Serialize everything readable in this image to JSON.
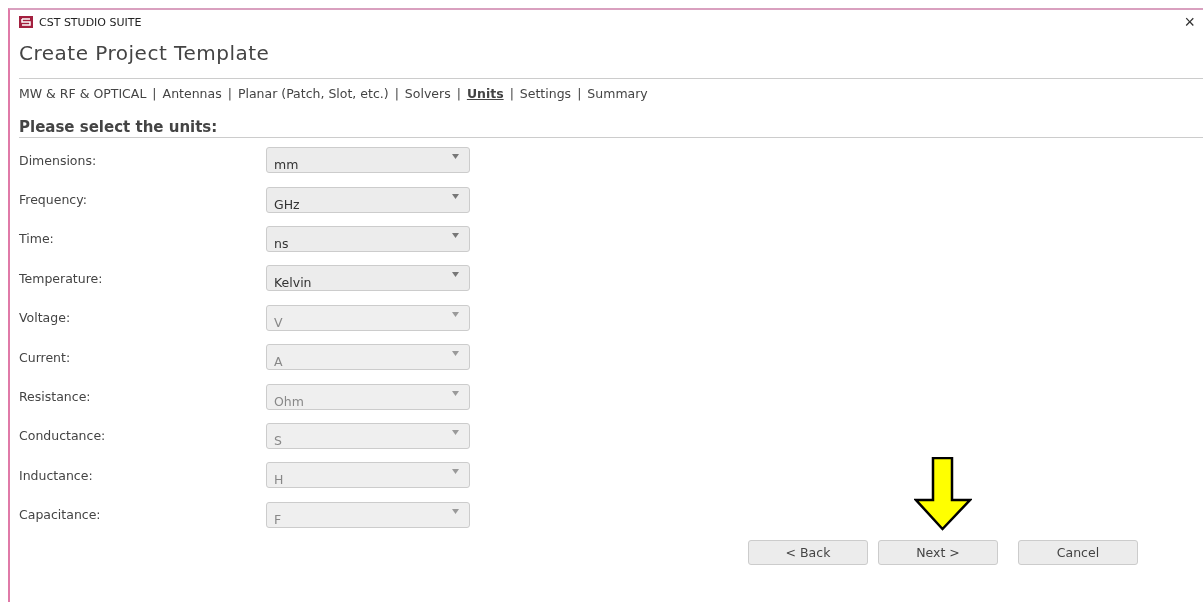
{
  "window": {
    "title": "CST STUDIO SUITE",
    "close": "×"
  },
  "heading": "Create Project Template",
  "breadcrumbs": {
    "separator": "|",
    "items": [
      {
        "label": "MW & RF & OPTICAL",
        "selected": false
      },
      {
        "label": "Antennas",
        "selected": false
      },
      {
        "label": "Planar (Patch, Slot, etc.)",
        "selected": false
      },
      {
        "label": "Solvers",
        "selected": false
      },
      {
        "label": "Units",
        "selected": true
      },
      {
        "label": "Settings",
        "selected": false
      },
      {
        "label": "Summary",
        "selected": false
      }
    ]
  },
  "section_title": "Please select the units:",
  "units": [
    {
      "label": "Dimensions:",
      "value": "mm",
      "disabled": false
    },
    {
      "label": "Frequency:",
      "value": "GHz",
      "disabled": false
    },
    {
      "label": "Time:",
      "value": "ns",
      "disabled": false
    },
    {
      "label": "Temperature:",
      "value": "Kelvin",
      "disabled": false
    },
    {
      "label": "Voltage:",
      "value": "V",
      "disabled": true
    },
    {
      "label": "Current:",
      "value": "A",
      "disabled": true
    },
    {
      "label": "Resistance:",
      "value": "Ohm",
      "disabled": true
    },
    {
      "label": "Conductance:",
      "value": "S",
      "disabled": true
    },
    {
      "label": "Inductance:",
      "value": "H",
      "disabled": true
    },
    {
      "label": "Capacitance:",
      "value": "F",
      "disabled": true
    }
  ],
  "buttons": [
    {
      "label": "< Back"
    },
    {
      "label": "Next >"
    },
    {
      "label": "Cancel"
    }
  ]
}
